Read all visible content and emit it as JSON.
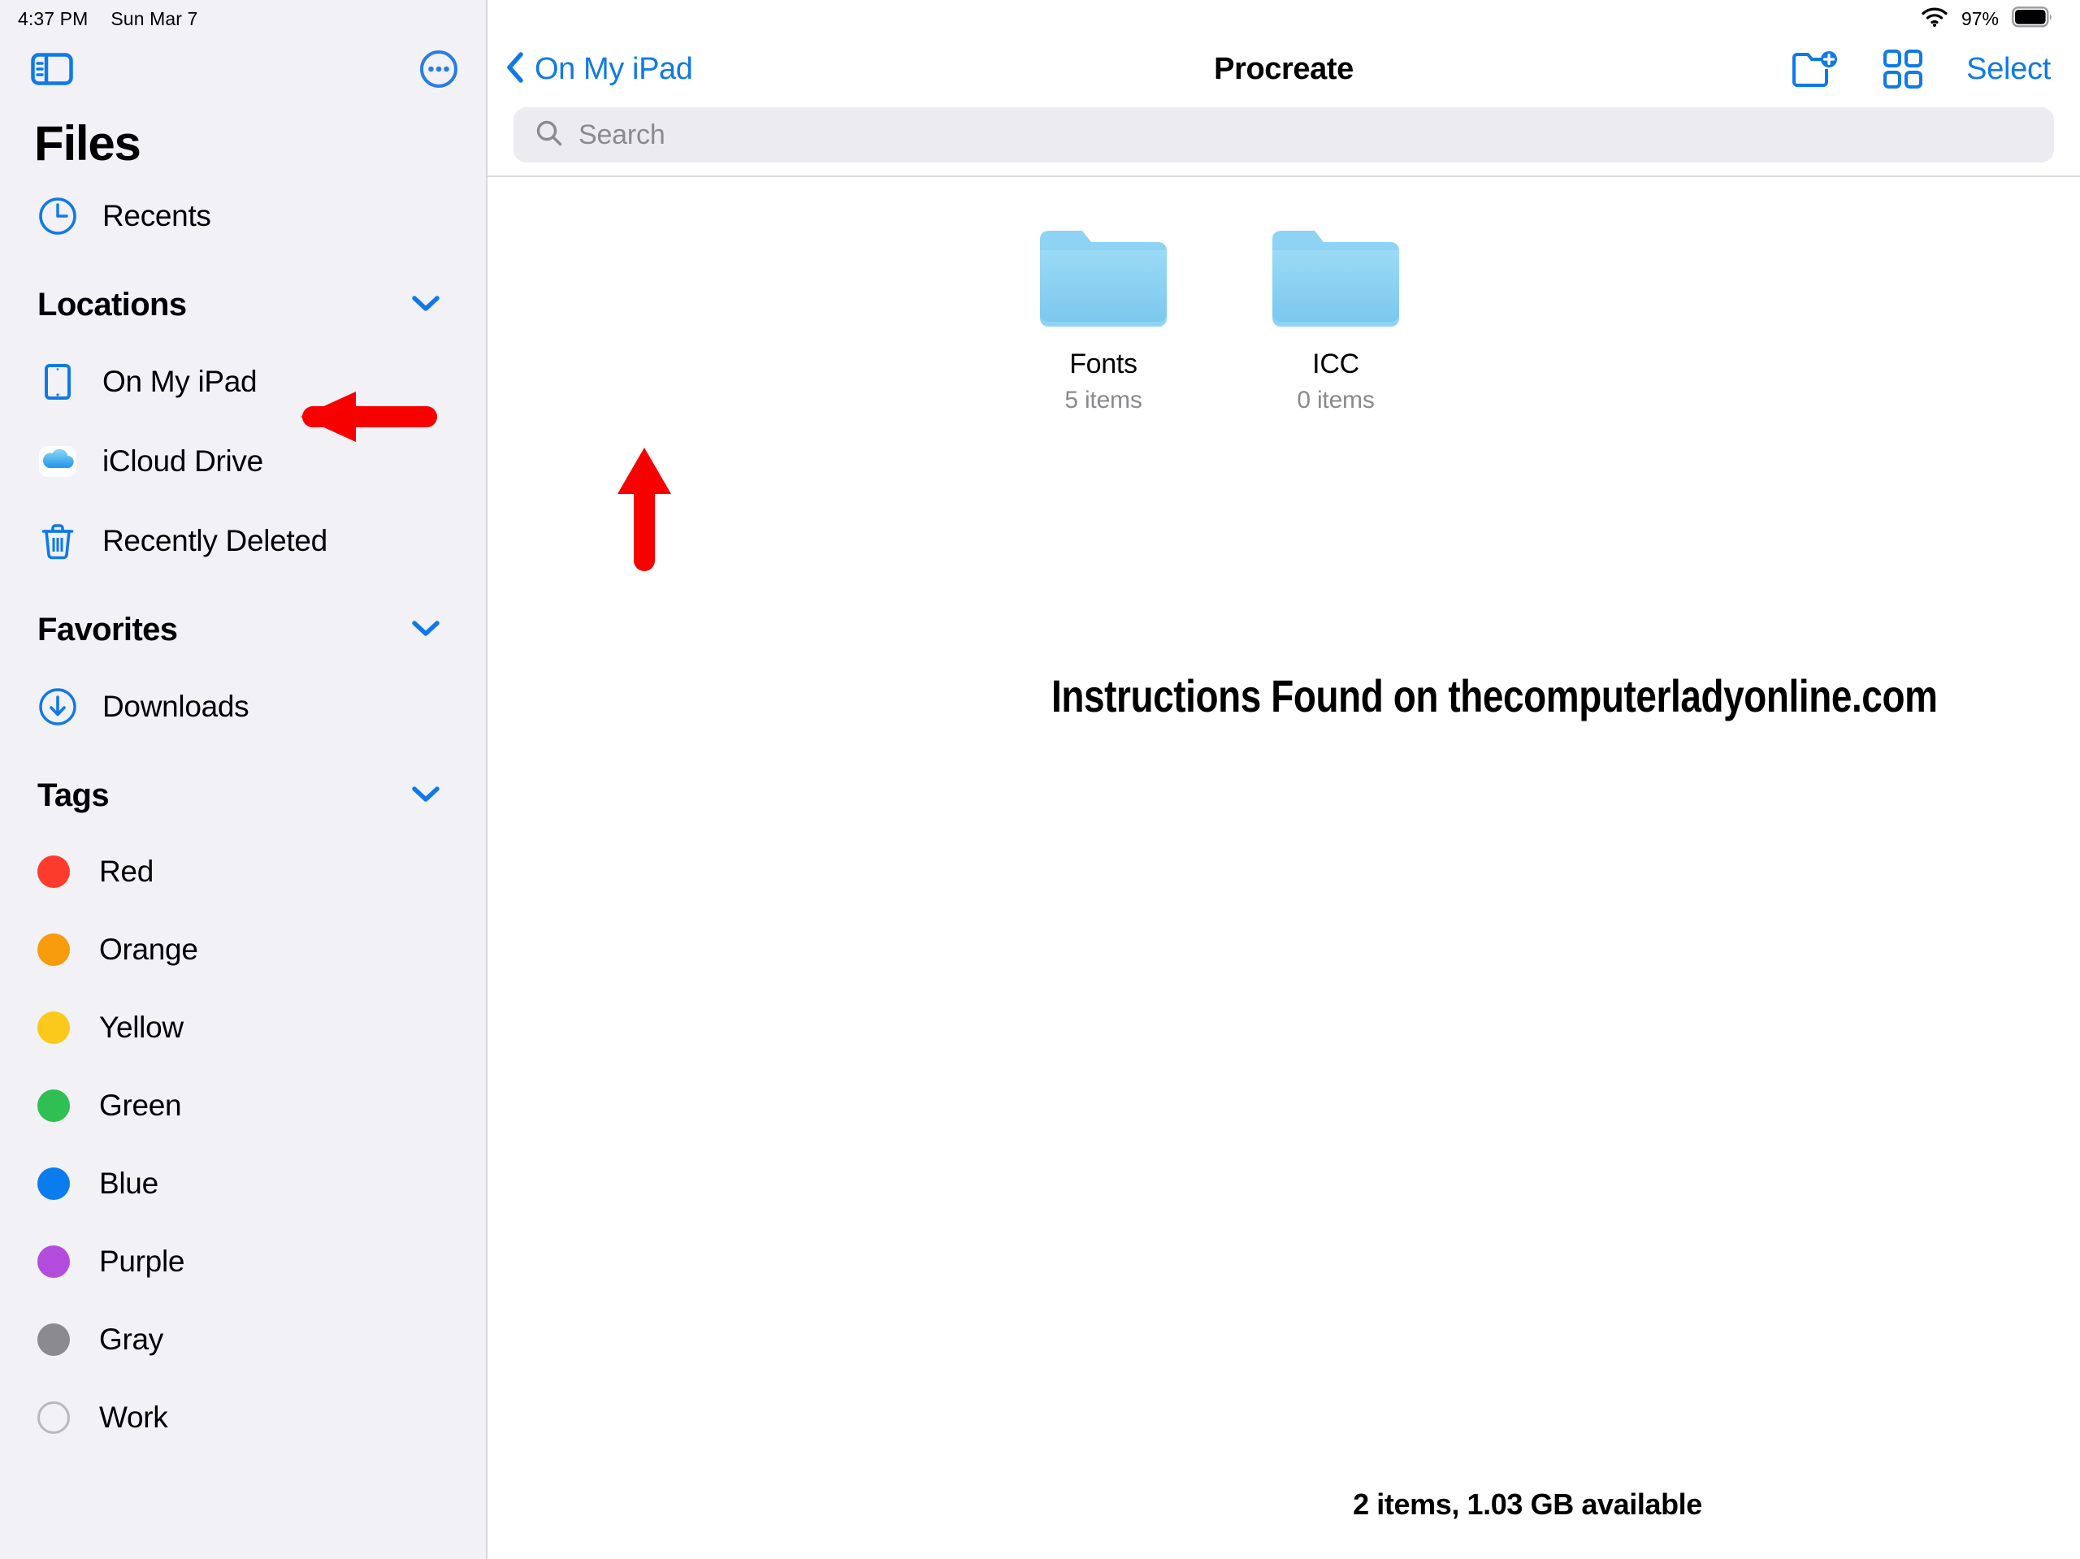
{
  "status_bar": {
    "time": "4:37 PM",
    "date": "Sun Mar 7",
    "battery_percent": "97%",
    "wifi_icon": "wifi-icon",
    "battery_icon": "battery-full-icon"
  },
  "sidebar": {
    "toggle_icon": "sidebar-toggle-icon",
    "more_icon": "more-circle-icon",
    "title": "Files",
    "recents": {
      "label": "Recents",
      "icon": "clock-icon"
    },
    "sections": [
      {
        "title": "Locations",
        "chevron": "chevron-down-icon",
        "items": [
          {
            "label": "On My iPad",
            "icon": "ipad-icon"
          },
          {
            "label": "iCloud Drive",
            "icon": "icloud-icon"
          },
          {
            "label": "Recently Deleted",
            "icon": "trash-icon"
          }
        ]
      },
      {
        "title": "Favorites",
        "chevron": "chevron-down-icon",
        "items": [
          {
            "label": "Downloads",
            "icon": "download-circle-icon"
          }
        ]
      },
      {
        "title": "Tags",
        "chevron": "chevron-down-icon",
        "items": [
          {
            "label": "Red",
            "icon": "tag-dot-icon",
            "color": "#FC3B2D"
          },
          {
            "label": "Orange",
            "icon": "tag-dot-icon",
            "color": "#F89B0C"
          },
          {
            "label": "Yellow",
            "icon": "tag-dot-icon",
            "color": "#FBC91B"
          },
          {
            "label": "Green",
            "icon": "tag-dot-icon",
            "color": "#2FBF52"
          },
          {
            "label": "Blue",
            "icon": "tag-dot-icon",
            "color": "#0B7CEE"
          },
          {
            "label": "Purple",
            "icon": "tag-dot-icon",
            "color": "#B34CDD"
          },
          {
            "label": "Gray",
            "icon": "tag-dot-icon",
            "color": "#8A8A8F"
          },
          {
            "label": "Work",
            "icon": "tag-dot-outline-icon",
            "color": ""
          }
        ]
      }
    ]
  },
  "main": {
    "back_label": "On My iPad",
    "back_icon": "chevron-left-icon",
    "title": "Procreate",
    "toolbar": {
      "new_folder_icon": "new-folder-icon",
      "grid_view_icon": "grid-view-icon",
      "select_label": "Select"
    },
    "search": {
      "placeholder": "Search",
      "icon": "search-icon",
      "value": ""
    },
    "files": [
      {
        "name": "Fonts",
        "subtitle": "5 items",
        "icon": "folder-icon"
      },
      {
        "name": "ICC",
        "subtitle": "0 items",
        "icon": "folder-icon"
      }
    ],
    "overlay_text": "Instructions Found on thecomputerladyonline.com",
    "footer_status": "2 items, 1.03 GB available"
  },
  "annotations": {
    "arrow_color": "#F80000",
    "arrow_left": "arrow-pointing-to-on-my-ipad",
    "arrow_up": "arrow-pointing-to-fonts-folder"
  },
  "colors": {
    "accent_blue": "#1079E8",
    "sidebar_bg": "#F1F1F6",
    "folder_blue": "#85CFF0"
  }
}
